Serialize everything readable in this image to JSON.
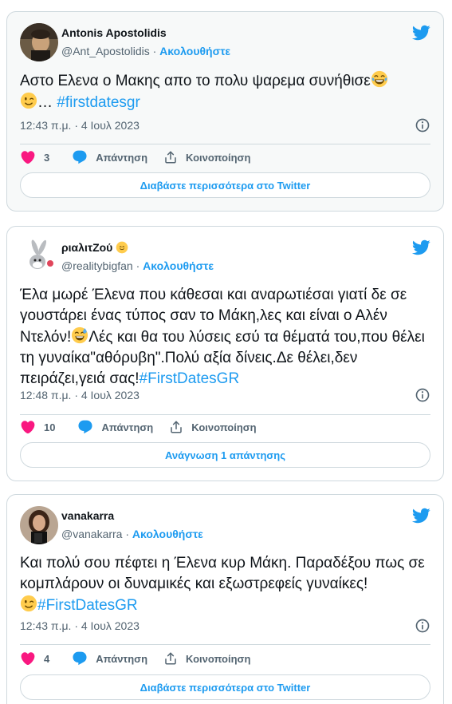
{
  "tweets": [
    {
      "author": "Antonis Apostolidis",
      "handle": "@Ant_Apostolidis",
      "follow": "Ακολουθήστε",
      "text_before": "Αστο Ελενα ο Μακης απο το πολυ ψαρεμα συνήθισε",
      "text_ellipsis": "…",
      "hashtag": "#firstdatesgr",
      "timestamp": "12:43 π.μ. · 4 Ιουλ 2023",
      "likes": "3",
      "reply_label": "Απάντηση",
      "share_label": "Κοινοποίηση",
      "cta": "Διαβάστε περισσότερα στο Twitter"
    },
    {
      "author": "ριαλιτΖού",
      "handle": "@realitybigfan",
      "follow": "Ακολουθήστε",
      "text_part1": "Έλα μωρέ Έλενα που κάθεσαι και αναρωτιέσαι γιατί δε σε γουστάρει ένας τύπος σαν το Μάκη,λες και είναι ο Αλέν Ντελόν!",
      "text_part2": "Λές και θα του λύσεις εσύ τα θέματά του,που θέλει τη γυναίκα\"αθόρυβη\".Πολύ αξία δίνεις.Δε θέλει,δεν πειράζει,γειά σας!",
      "hashtag": "#FirstDatesGR",
      "timestamp": "12:48 π.μ. · 4 Ιουλ 2023",
      "likes": "10",
      "reply_label": "Απάντηση",
      "share_label": "Κοινοποίηση",
      "cta": "Ανάγνωση 1 απάντησης"
    },
    {
      "author": "vanakarra",
      "handle": "@vanakarra",
      "follow": "Ακολουθήστε",
      "text_before": "Και πολύ σου πέφτει η Έλενα κυρ Μάκη. Παραδέξου πως σε κομπλάρουν οι δυναμικές και εξωστρεφείς γυναίκες!",
      "hashtag": "#FirstDatesGR",
      "timestamp": "12:43 π.μ. · 4 Ιουλ 2023",
      "likes": "4",
      "reply_label": "Απάντηση",
      "share_label": "Κοινοποίηση",
      "cta": "Διαβάστε περισσότερα στο Twitter"
    }
  ],
  "colors": {
    "accent": "#1d9bf0",
    "like": "#f91880",
    "border": "#cfd9de",
    "muted": "#536471"
  },
  "icons": [
    "twitter-bird-icon",
    "heart-icon",
    "reply-bubble-icon",
    "share-icon",
    "info-icon",
    "laughing-tears-emoji",
    "winking-face-emoji",
    "sweat-smile-emoji",
    "verified-badge-icon"
  ]
}
